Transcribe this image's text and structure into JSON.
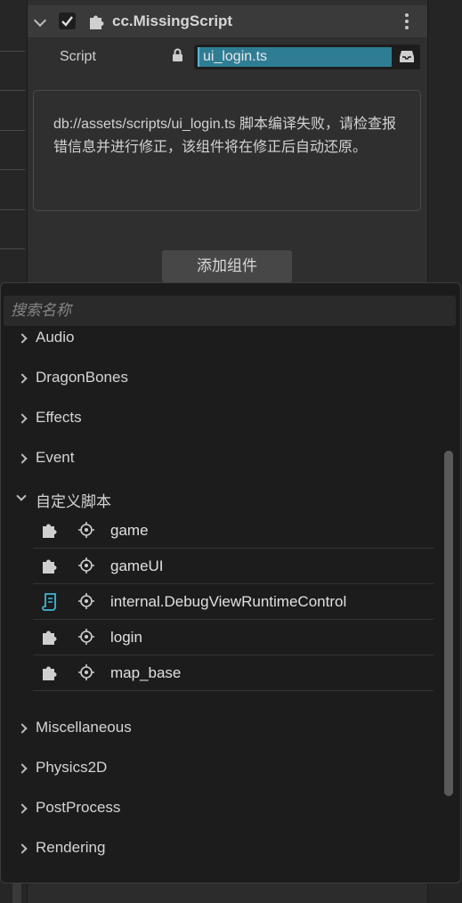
{
  "component": {
    "title": "cc.MissingScript",
    "enabled": true,
    "script_label": "Script",
    "script_value": "ui_login.ts",
    "error_message": "db://assets/scripts/ui_login.ts 脚本编译失败，请检查报错信息并进行修正，该组件将在修正后自动还原。"
  },
  "add_component_button": "添加组件",
  "popup": {
    "search_placeholder": "搜索名称",
    "categories_top": [
      {
        "label": "Audio"
      },
      {
        "label": "DragonBones"
      },
      {
        "label": "Effects"
      },
      {
        "label": "Event"
      }
    ],
    "expanded_category": {
      "label": "自定义脚本",
      "items": [
        {
          "label": "game",
          "icon": "puzzle-icon"
        },
        {
          "label": "gameUI",
          "icon": "puzzle-icon"
        },
        {
          "label": "internal.DebugViewRuntimeControl",
          "icon": "script-scroll-icon"
        },
        {
          "label": "login",
          "icon": "puzzle-icon"
        },
        {
          "label": "map_base",
          "icon": "puzzle-icon"
        }
      ]
    },
    "categories_bottom": [
      {
        "label": "Miscellaneous"
      },
      {
        "label": "Physics2D"
      },
      {
        "label": "PostProcess"
      },
      {
        "label": "Rendering"
      }
    ]
  },
  "colors": {
    "accent": "#2f7d94",
    "script_icon": "#3fb6d8"
  }
}
